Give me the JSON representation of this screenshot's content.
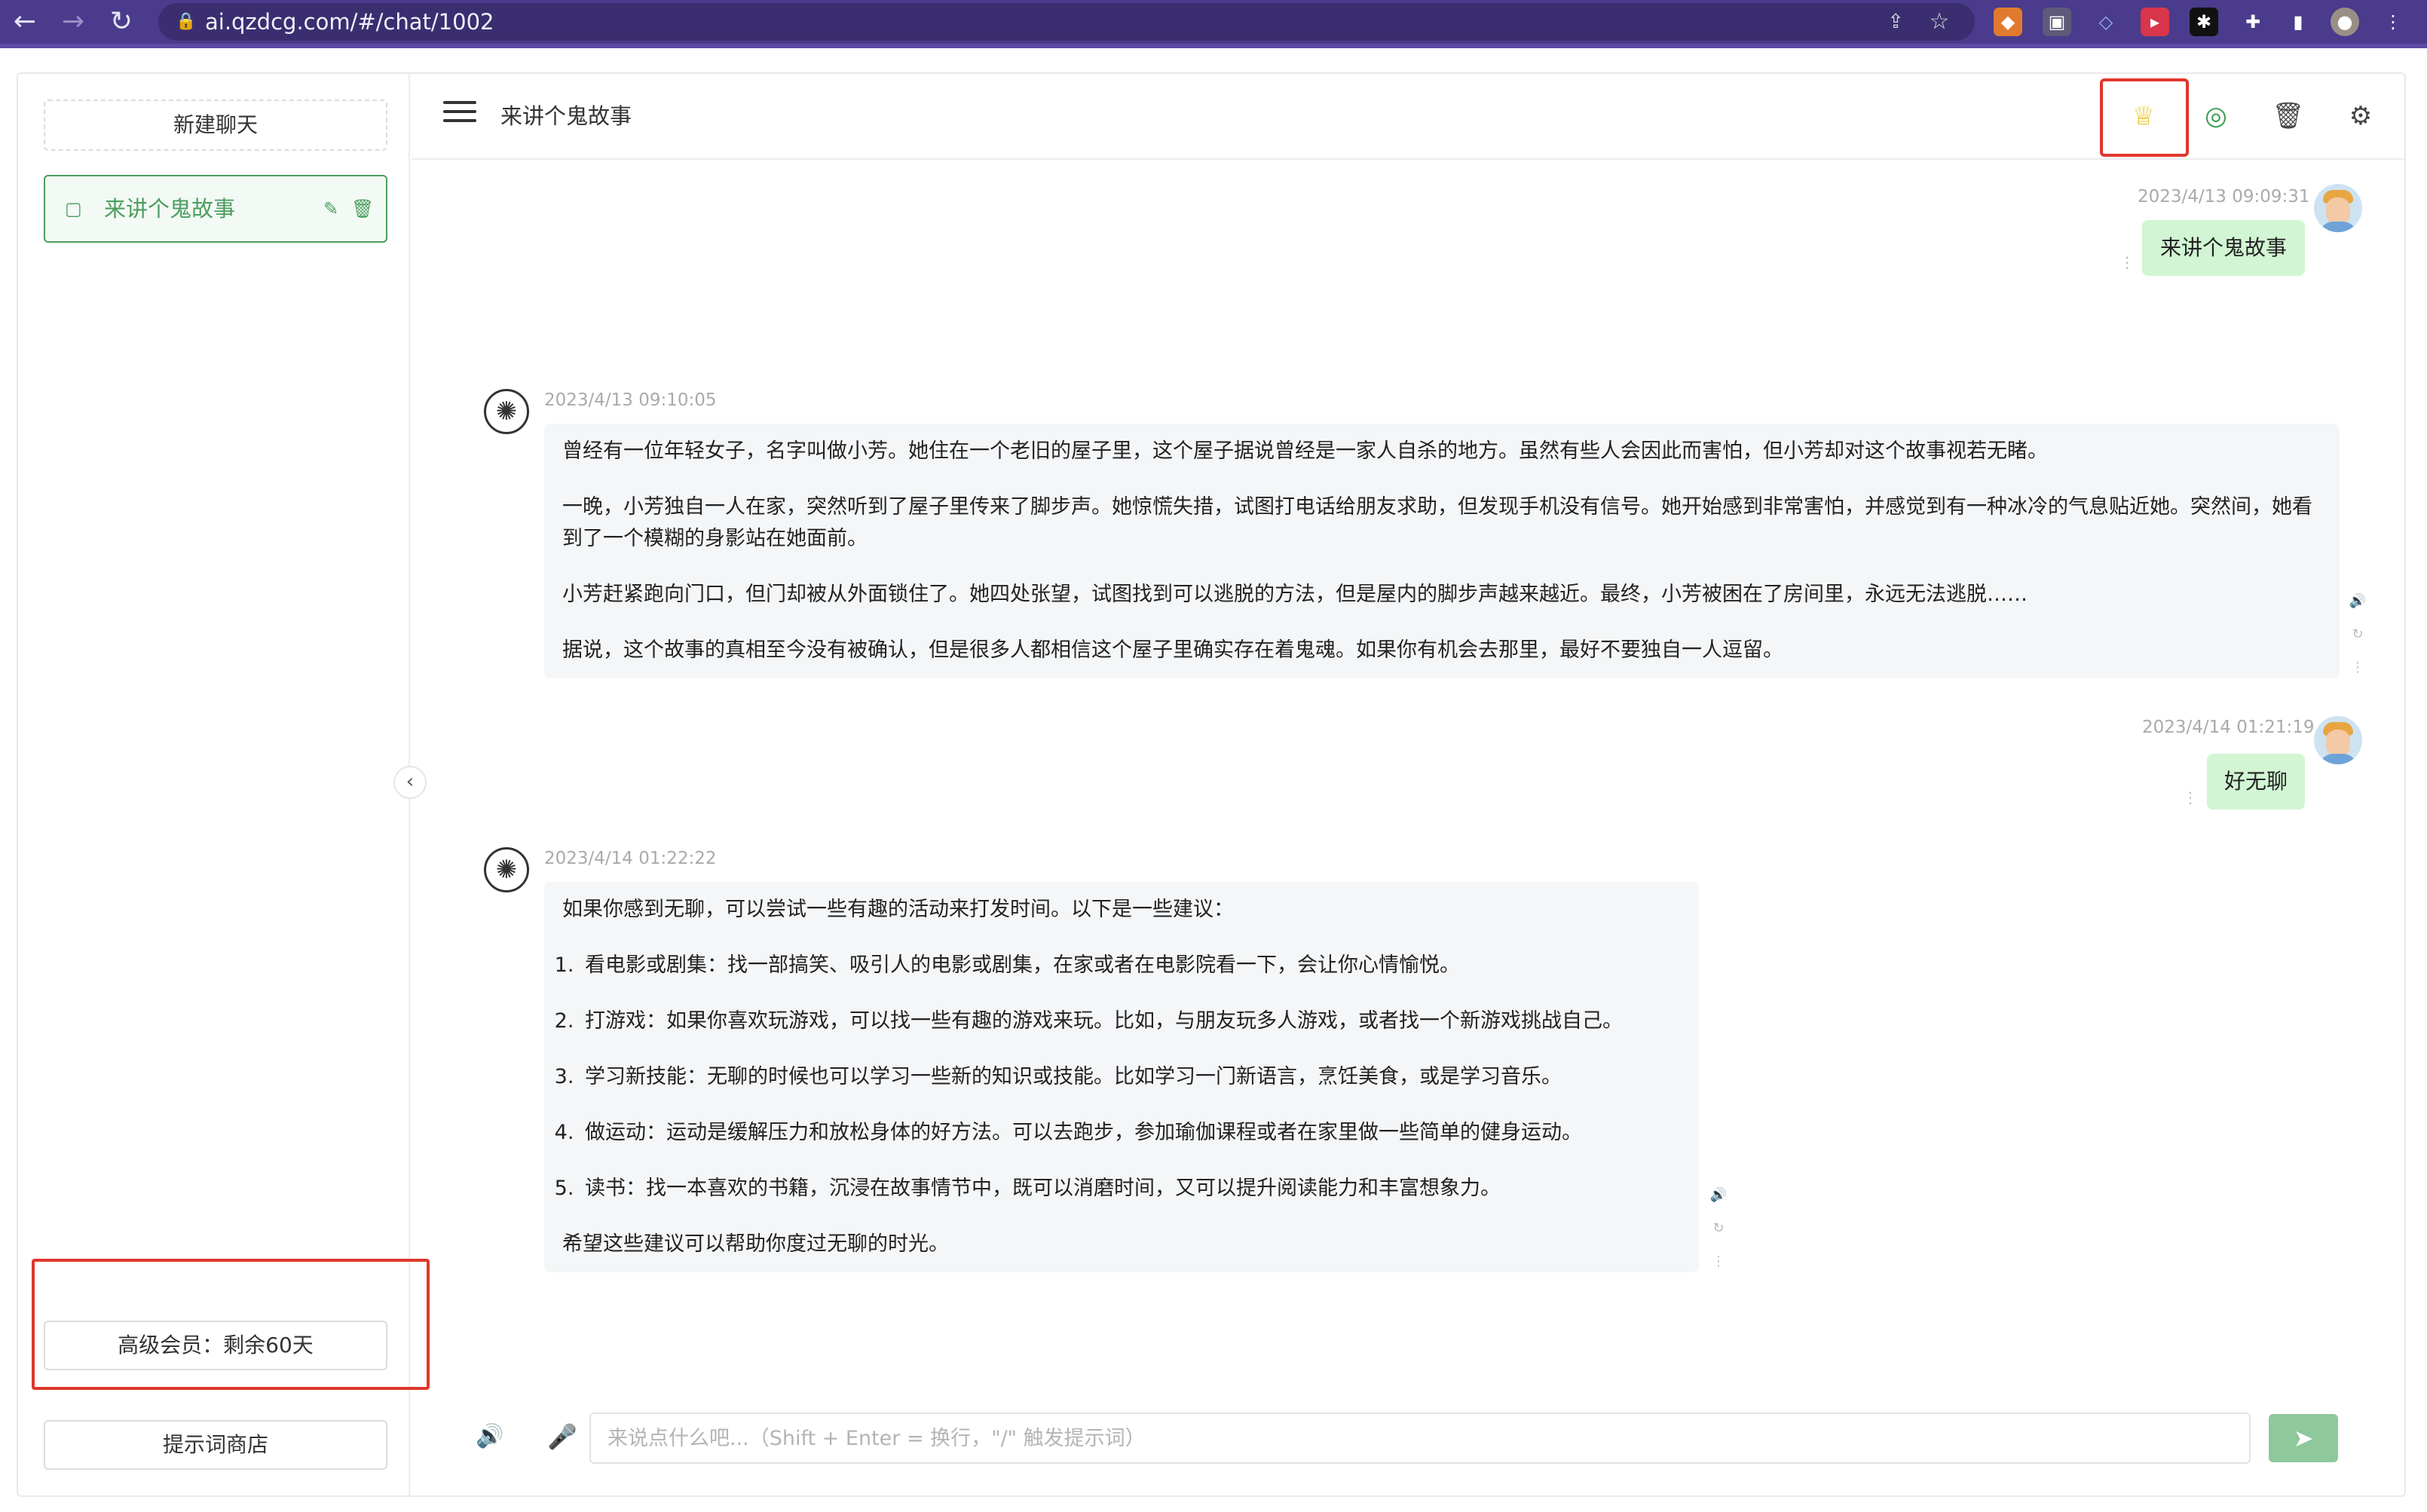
{
  "browser": {
    "url": "ai.qzdcg.com/#/chat/1002",
    "back": "←",
    "forward": "→",
    "reload": "↻"
  },
  "sidebar": {
    "new_chat_label": "新建聊天",
    "chats": [
      {
        "title": "来讲个鬼故事",
        "active": true
      }
    ],
    "membership_label": "高级会员：剩余60天",
    "prompt_store_label": "提示词商店"
  },
  "header": {
    "title": "来讲个鬼故事",
    "icons": [
      "crown-icon",
      "whatsapp-icon",
      "trash-icon",
      "settings-icon"
    ],
    "accent_color": "#e6c21a"
  },
  "messages": [
    {
      "role": "user",
      "time": "2023/4/13 09:09:31",
      "text": "来讲个鬼故事"
    },
    {
      "role": "assistant",
      "time": "2023/4/13 09:10:05",
      "paragraphs": [
        "曾经有一位年轻女子，名字叫做小芳。她住在一个老旧的屋子里，这个屋子据说曾经是一家人自杀的地方。虽然有些人会因此而害怕，但小芳却对这个故事视若无睹。",
        "一晚，小芳独自一人在家，突然听到了屋子里传来了脚步声。她惊慌失措，试图打电话给朋友求助，但发现手机没有信号。她开始感到非常害怕，并感觉到有一种冰冷的气息贴近她。突然间，她看到了一个模糊的身影站在她面前。",
        "小芳赶紧跑向门口，但门却被从外面锁住了。她四处张望，试图找到可以逃脱的方法，但是屋内的脚步声越来越近。最终，小芳被困在了房间里，永远无法逃脱……",
        "据说，这个故事的真相至今没有被确认，但是很多人都相信这个屋子里确实存在着鬼魂。如果你有机会去那里，最好不要独自一人逗留。"
      ]
    },
    {
      "role": "user",
      "time": "2023/4/14 01:21:19",
      "text": "好无聊"
    },
    {
      "role": "assistant",
      "time": "2023/4/14 01:22:22",
      "intro": "如果你感到无聊，可以尝试一些有趣的活动来打发时间。以下是一些建议：",
      "list": [
        "看电影或剧集：找一部搞笑、吸引人的电影或剧集，在家或者在电影院看一下，会让你心情愉悦。",
        "打游戏：如果你喜欢玩游戏，可以找一些有趣的游戏来玩。比如，与朋友玩多人游戏，或者找一个新游戏挑战自己。",
        "学习新技能：无聊的时候也可以学习一些新的知识或技能。比如学习一门新语言，烹饪美食，或是学习音乐。",
        "做运动：运动是缓解压力和放松身体的好方法。可以去跑步，参加瑜伽课程或者在家里做一些简单的健身运动。",
        "读书：找一本喜欢的书籍，沉浸在故事情节中，既可以消磨时间，又可以提升阅读能力和丰富想象力。"
      ],
      "outro": "希望这些建议可以帮助你度过无聊的时光。"
    }
  ],
  "input": {
    "placeholder": "来说点什么吧...（Shift + Enter = 换行，\"/\" 触发提示词）",
    "value": ""
  },
  "colors": {
    "brand_green": "#4b9e5f",
    "user_bubble": "#d2f5d3",
    "highlight_red": "#e0362c",
    "browser_purple": "#4a3b8c"
  }
}
